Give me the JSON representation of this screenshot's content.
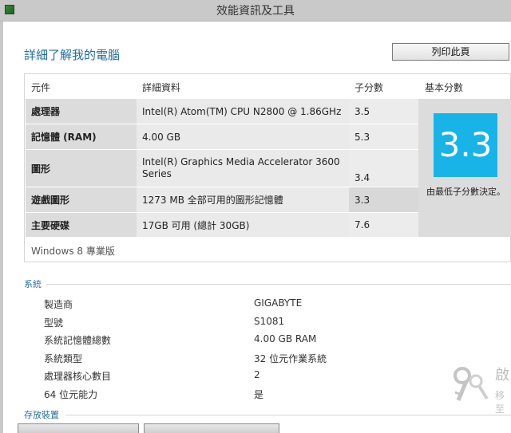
{
  "window": {
    "title": "效能資訊及工具"
  },
  "page": {
    "title": "詳細了解我的電腦",
    "print_label": "列印此頁"
  },
  "scores": {
    "headers": {
      "component": "元件",
      "details": "詳細資料",
      "subscore": "子分數",
      "basescore": "基本分數"
    },
    "rows": [
      {
        "component": "處理器",
        "details": "Intel(R) Atom(TM) CPU N2800 @ 1.86GHz",
        "subscore": "3.5"
      },
      {
        "component": "記憶體 (RAM)",
        "details": "4.00 GB",
        "subscore": "5.3"
      },
      {
        "component": "圖形",
        "details_line1": "Intel(R) Graphics Media Accelerator 3600",
        "details_line2": "Series",
        "subscore": "3.4"
      },
      {
        "component": "遊戲圖形",
        "details": "1273 MB 全部可用的圖形記憶體",
        "subscore": "3.3"
      },
      {
        "component": "主要硬碟",
        "details": "17GB 可用 (總計 30GB)",
        "subscore": "7.6"
      }
    ],
    "base_score": "3.3",
    "base_note": "由最低子分數決定。",
    "os_edition": "Windows 8 專業版",
    "tile_color": "#18b4e8"
  },
  "system": {
    "heading": "系統",
    "items": [
      {
        "label": "製造商",
        "value": "GIGABYTE"
      },
      {
        "label": "型號",
        "value": "S1081"
      },
      {
        "label": "系統記憶體總數",
        "value": "4.00 GB RAM"
      },
      {
        "label": "系統類型",
        "value": "32 位元作業系統"
      },
      {
        "label": "處理器核心數目",
        "value": "2"
      },
      {
        "label": "64 位元能力",
        "value": "是"
      }
    ]
  },
  "storage": {
    "heading": "存放裝置"
  },
  "watermark": {
    "text": "啟",
    "sub": "移至"
  }
}
